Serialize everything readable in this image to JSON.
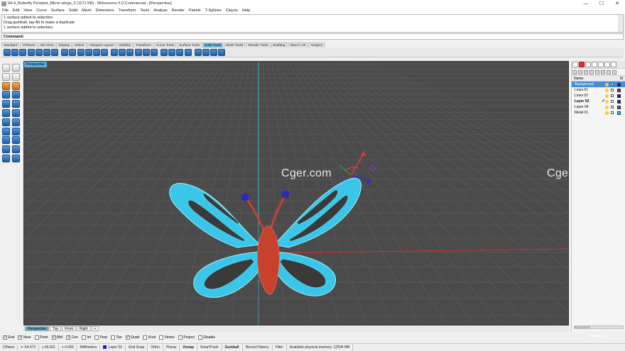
{
  "window": {
    "title": "04-4_Butterfly Pendant_Mirror wings_2 (1171 KB) - Rhinoceros 5.0 Commercial - [Perspective]",
    "controls": [
      "—",
      "☐",
      "✕"
    ]
  },
  "menu": [
    "File",
    "Edit",
    "View",
    "Curve",
    "Surface",
    "Solid",
    "Mesh",
    "Dimension",
    "Transform",
    "Tools",
    "Analyze",
    "Render",
    "Panels",
    "T-Splines",
    "Clayoo",
    "Help"
  ],
  "history": [
    "1 surface added to selection.",
    "Drag gumball, tap Alt to make a duplicate",
    "1 surface added to selection."
  ],
  "command": {
    "label": "Command:",
    "value": ""
  },
  "toolbar_tabs": [
    {
      "label": "Standard",
      "active": false
    },
    {
      "label": "CPlanes",
      "active": false
    },
    {
      "label": "Set View",
      "active": false
    },
    {
      "label": "Display",
      "active": false
    },
    {
      "label": "Select",
      "active": false
    },
    {
      "label": "Viewport Layout",
      "active": false
    },
    {
      "label": "Visibility",
      "active": false
    },
    {
      "label": "Transform",
      "active": false
    },
    {
      "label": "Curve Tools",
      "active": false
    },
    {
      "label": "Surface Tools",
      "active": false
    },
    {
      "label": "Solid Tools",
      "active": true
    },
    {
      "label": "Mesh Tools",
      "active": false
    },
    {
      "label": "Render Tools",
      "active": false
    },
    {
      "label": "Drafting",
      "active": false
    },
    {
      "label": "New in V5",
      "active": false
    },
    {
      "label": "Analyze",
      "active": false
    }
  ],
  "viewport": {
    "label": "Perspective",
    "watermark_left": "Cger.com",
    "watermark_right": "Cger.com",
    "colors": {
      "background": "#4b4b4b",
      "grid": "#5e5e5e",
      "wing": "#39c6e8",
      "body": "#c8412f",
      "antenna_tip": "#2a2ab4"
    }
  },
  "viewport_tabs": [
    {
      "label": "Perspective",
      "active": true
    },
    {
      "label": "Top",
      "active": false
    },
    {
      "label": "Front",
      "active": false
    },
    {
      "label": "Right",
      "active": false
    },
    {
      "label": "+",
      "active": false
    }
  ],
  "osnaps": [
    {
      "label": "End",
      "checked": true
    },
    {
      "label": "Near",
      "checked": true
    },
    {
      "label": "Point",
      "checked": false
    },
    {
      "label": "Mid",
      "checked": true
    },
    {
      "label": "Cen",
      "checked": true
    },
    {
      "label": "Int",
      "checked": false
    },
    {
      "label": "Perp",
      "checked": false
    },
    {
      "label": "Tan",
      "checked": false
    },
    {
      "label": "Quad",
      "checked": true
    },
    {
      "label": "Knot",
      "checked": false
    },
    {
      "label": "Vertex",
      "checked": false
    },
    {
      "label": "Project",
      "checked": false
    },
    {
      "label": "Disable",
      "checked": false
    }
  ],
  "status": {
    "cplane": "CPlane",
    "x": "x -54.472",
    "y": "y 65.811",
    "z": "z 0.000",
    "units": "Millimeters",
    "layer": "Layer 03",
    "toggles": [
      {
        "label": "Grid Snap",
        "bold": false
      },
      {
        "label": "Ortho",
        "bold": false
      },
      {
        "label": "Planar",
        "bold": false
      },
      {
        "label": "Osnap",
        "bold": true
      },
      {
        "label": "SmartTrack",
        "bold": false
      },
      {
        "label": "Gumball",
        "bold": true
      },
      {
        "label": "Record History",
        "bold": false
      },
      {
        "label": "Filter",
        "bold": false
      }
    ],
    "memory": "Available physical memory: 12594 MB"
  },
  "layers": {
    "header": "Name",
    "material_col": "M",
    "rows": [
      {
        "name": "Background",
        "color": "#1a1acc",
        "selected": true,
        "current": false
      },
      {
        "name": "Lines 01",
        "color": "#cc1a1a",
        "selected": false,
        "current": false
      },
      {
        "name": "Lines 02",
        "color": "#1a1acc",
        "selected": false,
        "current": false
      },
      {
        "name": "Layer 03",
        "color": "#1a1acc",
        "selected": false,
        "current": true
      },
      {
        "name": "Layer 04",
        "color": "#1a8a4a",
        "selected": false,
        "current": false
      },
      {
        "name": "Metal 01",
        "color": "#2ad0d0",
        "selected": false,
        "current": false
      }
    ],
    "current_mark": "✓"
  },
  "brand_watermark": "Udemy"
}
